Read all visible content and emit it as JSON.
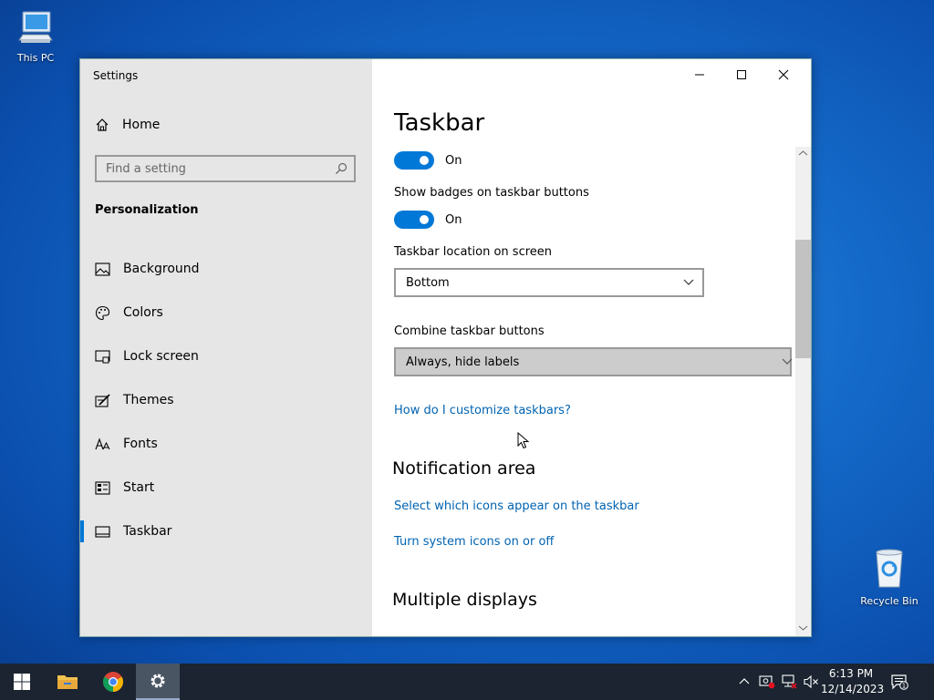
{
  "desktop": {
    "this_pc": "This PC",
    "recycle_bin": "Recycle Bin"
  },
  "window": {
    "title": "Settings"
  },
  "sidebar": {
    "home": "Home",
    "search_placeholder": "Find a setting",
    "section": "Personalization",
    "items": [
      {
        "label": "Background",
        "icon": "image-icon"
      },
      {
        "label": "Colors",
        "icon": "palette-icon"
      },
      {
        "label": "Lock screen",
        "icon": "lock-screen-icon"
      },
      {
        "label": "Themes",
        "icon": "themes-icon"
      },
      {
        "label": "Fonts",
        "icon": "fonts-icon"
      },
      {
        "label": "Start",
        "icon": "start-icon"
      },
      {
        "label": "Taskbar",
        "icon": "taskbar-icon",
        "active": true
      }
    ]
  },
  "content": {
    "title": "Taskbar",
    "toggle1_state": "On",
    "badges_label": "Show badges on taskbar buttons",
    "toggle2_state": "On",
    "location_label": "Taskbar location on screen",
    "location_value": "Bottom",
    "combine_label": "Combine taskbar buttons",
    "combine_value": "Always, hide labels",
    "customize_link": "How do I customize taskbars?",
    "notification_heading": "Notification area",
    "select_icons_link": "Select which icons appear on the taskbar",
    "system_icons_link": "Turn system icons on or off",
    "multiple_displays_heading": "Multiple displays"
  },
  "taskbar": {
    "time": "6:13 PM",
    "date": "12/14/2023",
    "notification_count": "1"
  },
  "colors": {
    "accent": "#0078d7",
    "link": "#0063b1",
    "sidebar_bg": "#e6e6e6",
    "taskbar_bg": "#1b2430"
  }
}
